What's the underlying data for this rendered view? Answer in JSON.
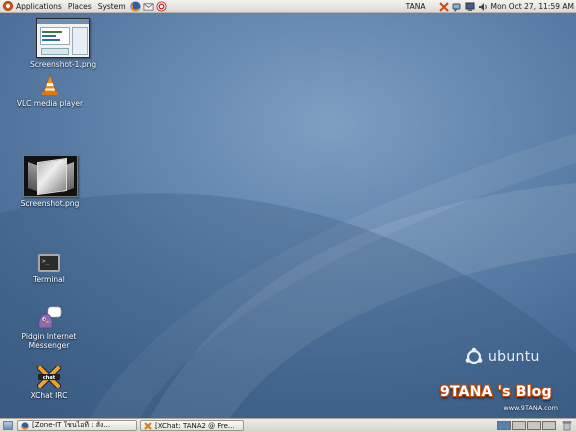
{
  "top_panel": {
    "menus": [
      "Applications",
      "Places",
      "System"
    ],
    "launchers": [
      "firefox-icon",
      "mail-icon",
      "help-icon"
    ],
    "user": "TANA",
    "clock": "Mon Oct 27, 11:59 AM",
    "tray": [
      "network-tools-icon",
      "chat-icon",
      "display-icon",
      "volume-icon"
    ]
  },
  "desktop_icons": [
    {
      "label": "Screenshot-1.png",
      "icon": "image-thumbnail-icon"
    },
    {
      "label": "VLC media player",
      "icon": "vlc-cone-icon"
    },
    {
      "label": "Screenshot.png",
      "icon": "image-thumbnail-icon"
    },
    {
      "label": "Terminal",
      "icon": "terminal-icon"
    },
    {
      "label_lines": [
        "Pidgin Internet",
        "Messenger"
      ],
      "icon": "pidgin-icon"
    },
    {
      "label": "XChat IRC",
      "icon": "xchat-icon"
    }
  ],
  "branding": {
    "ubuntu": "ubuntu",
    "blog_title": "9TANA 's Blog",
    "blog_url": "www.9TANA.com"
  },
  "taskbar": {
    "tasks": [
      {
        "label": "[Zone-IT ใชนไอที : สัง..."
      },
      {
        "label": "[XChat: TANA2 @ Fre..."
      }
    ],
    "workspaces": 4,
    "active_workspace": 1
  },
  "colors": {
    "wallpaper": "#4a6b8f",
    "panel": "#dcdad5",
    "ubuntu_orange": "#d6541d"
  }
}
